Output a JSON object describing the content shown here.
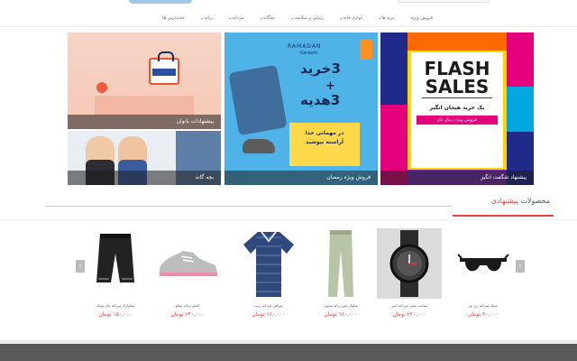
{
  "nav": {
    "items": [
      {
        "label": "جدیدترین ها",
        "caret": false
      },
      {
        "label": "زنانه",
        "caret": true
      },
      {
        "label": "مردانه",
        "caret": true
      },
      {
        "label": "بچگانه",
        "caret": true
      },
      {
        "label": "زیبایی و سلامت",
        "caret": true
      },
      {
        "label": "لوازم خانه",
        "caret": true
      },
      {
        "label": "برند ها",
        "caret": true
      },
      {
        "label": "فروش ویژه",
        "caret": false
      }
    ]
  },
  "banners": {
    "ladies": {
      "caption": "پیشنهادات بانوان"
    },
    "kids": {
      "caption": "بچه گانه"
    },
    "ramadan": {
      "caption": "فروش ویژه رمضان",
      "title": "RAMADAN",
      "subtitle": "Kareem",
      "line1": "3خرید",
      "plus": "+",
      "line2": "3هدیه",
      "box_line1": "در مهمانی خدا",
      "box_line2": "آراسته بپوشید"
    },
    "flash": {
      "caption": "پیشنهاد شگفت انگیز",
      "title1": "FLASH",
      "title2": "SALES",
      "sub1": "یک خرید هیجان انگیز",
      "sub2": "فروش ویژه زمان دار"
    }
  },
  "section": {
    "title_prefix": "محصولات",
    "title_highlight": "پیشنهادی"
  },
  "products": [
    {
      "name": "عینک مردانه ری بن",
      "price": "۳۰,۰۰۰ تومان",
      "icon": "sunglasses"
    },
    {
      "name": "ساعت مچی مردانه امپر",
      "price": "۲۲۰,۰۰۰ تومان",
      "icon": "watch"
    },
    {
      "name": "شلوار جین زنانه سیون",
      "price": "۱۸۰,۰۰۰ تومان",
      "icon": "pants"
    },
    {
      "name": "پیراهن مردانه زیپ",
      "price": "۱۶۰,۰۰۰ تومان",
      "icon": "shirt"
    },
    {
      "name": "کفش زنانه پیتکو",
      "price": "۲۴۰,۰۰۰ تومان",
      "icon": "sneaker"
    },
    {
      "name": "شلوارک مردانه جان وینک",
      "price": "۱۵۰,۰۰۰ تومان",
      "icon": "shorts"
    }
  ],
  "carousel": {
    "prev": "‹",
    "next": "›"
  }
}
